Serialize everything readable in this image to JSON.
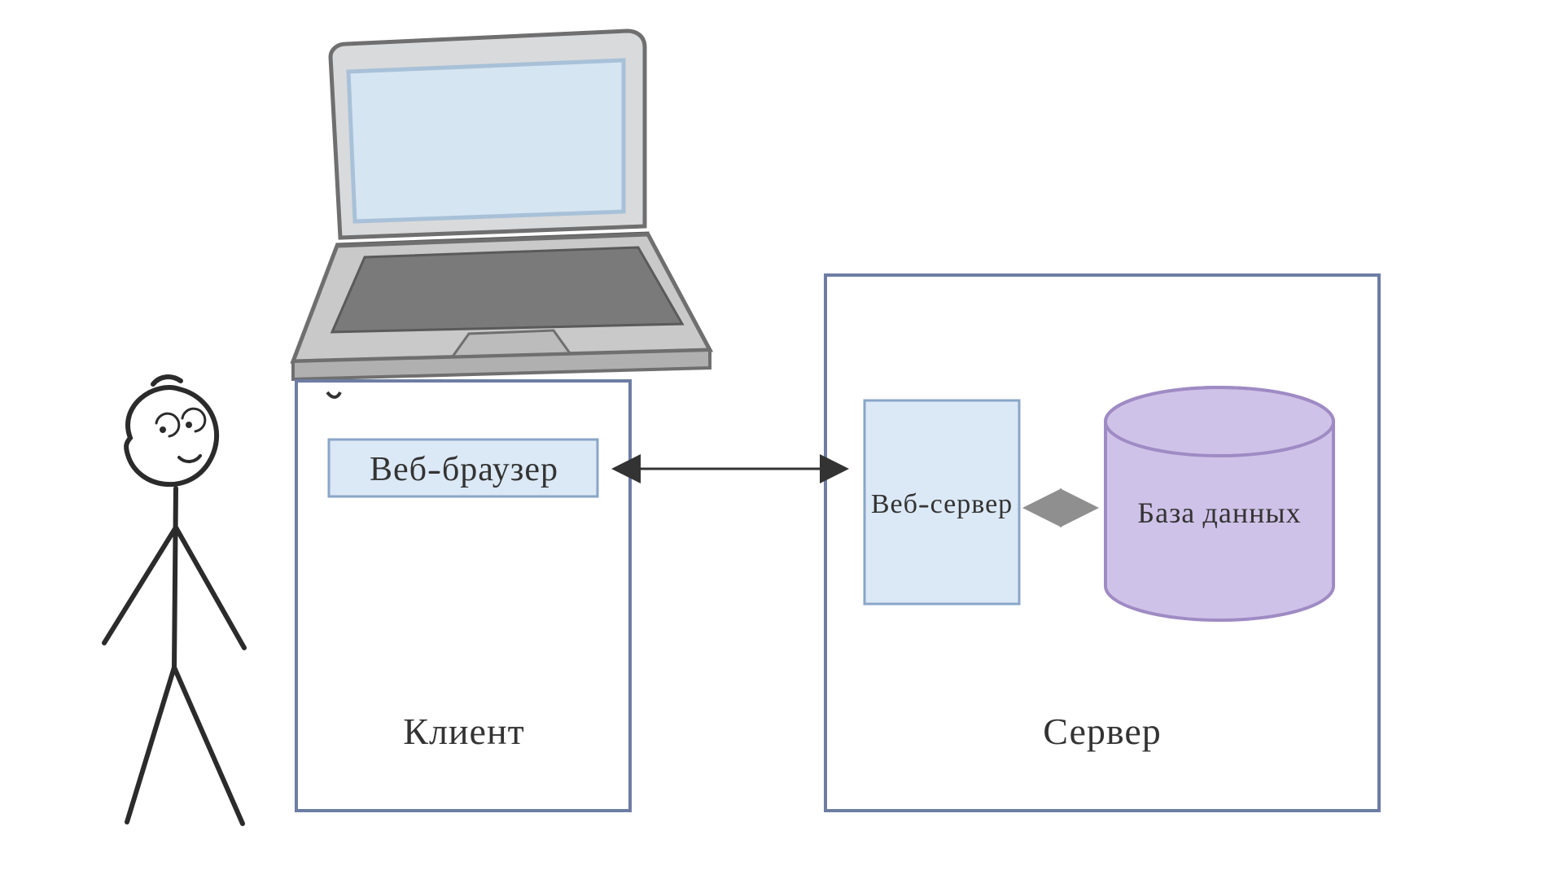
{
  "client": {
    "title": "Клиент",
    "browser_label": "Веб-браузер"
  },
  "server": {
    "title": "Сервер",
    "webserver_label": "Веб-сервер",
    "database_label": "База данных"
  },
  "colors": {
    "box_stroke": "#6d7da3",
    "light_blue_fill": "#dbe8f5",
    "light_blue_stroke": "#8aa6c9",
    "db_fill": "#cfc2e8",
    "db_stroke": "#9f8bc4",
    "laptop_grey": "#b9b9b9",
    "laptop_grey_dark": "#8a8a8a",
    "laptop_screen_fill": "#d5e5f2",
    "laptop_outline": "#545454",
    "person_stroke": "#2b2b2b",
    "arrow_black": "#333333",
    "arrow_grey": "#8f8f8f"
  }
}
